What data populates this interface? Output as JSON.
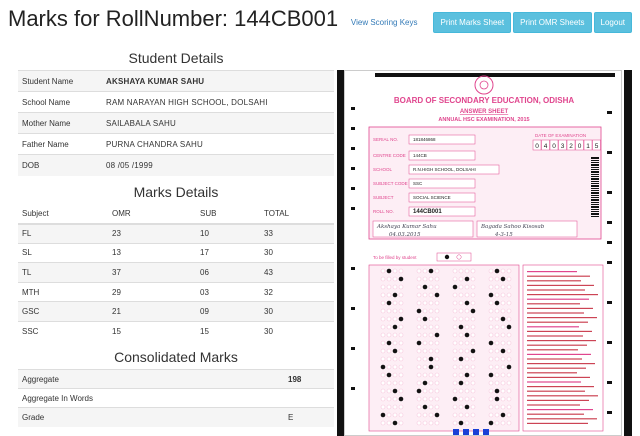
{
  "page": {
    "title": "Marks for RollNumber: 144CB001"
  },
  "toolbar": {
    "view_keys": "View Scoring Keys",
    "print_marks": "Print Marks Sheet",
    "print_omr": "Print OMR Sheets",
    "logout": "Logout"
  },
  "student": {
    "heading": "Student Details",
    "rows": [
      {
        "label": "Student Name",
        "value": "AKSHAYA KUMAR SAHU"
      },
      {
        "label": "School Name",
        "value": "RAM NARAYAN HIGH SCHOOL, DOLSAHI"
      },
      {
        "label": "Mother Name",
        "value": "SAILABALA SAHU"
      },
      {
        "label": "Father Name",
        "value": "PURNA CHANDRA SAHU"
      },
      {
        "label": "DOB",
        "value": "08 /05 /1999"
      }
    ]
  },
  "marks": {
    "heading": "Marks Details",
    "columns": [
      "Subject",
      "OMR",
      "SUB",
      "TOTAL"
    ],
    "rows": [
      [
        "FL",
        "23",
        "10",
        "33"
      ],
      [
        "SL",
        "13",
        "17",
        "30"
      ],
      [
        "TL",
        "37",
        "06",
        "43"
      ],
      [
        "MTH",
        "29",
        "03",
        "32"
      ],
      [
        "GSC",
        "21",
        "09",
        "30"
      ],
      [
        "SSC",
        "15",
        "15",
        "30"
      ]
    ]
  },
  "consolidated": {
    "heading": "Consolidated Marks",
    "rows": [
      {
        "label": "Aggregate",
        "value": "198"
      },
      {
        "label": "Aggregate In Words",
        "value": ""
      },
      {
        "label": "Grade",
        "value": "E"
      }
    ]
  },
  "omr": {
    "board": "BOARD OF SECONDARY EDUCATION, ODISHA",
    "sheet": "ANSWER SHEET",
    "exam": "ANNUAL HSC EXAMINATION, 2015",
    "serial_label": "SERIAL NO.",
    "serial": "181846868",
    "centre_label": "CENTRE CODE",
    "centre": "144CB",
    "school_label": "SCHOOL",
    "school": "R.N.HIGH SCHOOL, DOLSAHI",
    "subject_code_label": "SUBJECT CODE",
    "subject_code": "SSC",
    "subject_label": "SUBJECT",
    "subject": "SOCIAL SCIENCE",
    "roll_label": "ROLL NO.",
    "roll": "144CB001",
    "date_label": "DATE OF EXAMINATION",
    "date_digits": [
      "0",
      "4",
      "0",
      "3",
      "2",
      "0",
      "1",
      "5"
    ],
    "student_sign": "Akshaya Kumar Sahu",
    "student_date": "04.03.2015",
    "invig_sign": "Bagada Sahoo Kisosab",
    "invig_date": "4-3-15",
    "fill_label": "To be filled by student",
    "colors": {
      "pink": "#e0468e",
      "lightpink": "#f6c6dc",
      "mark": "#111"
    }
  }
}
